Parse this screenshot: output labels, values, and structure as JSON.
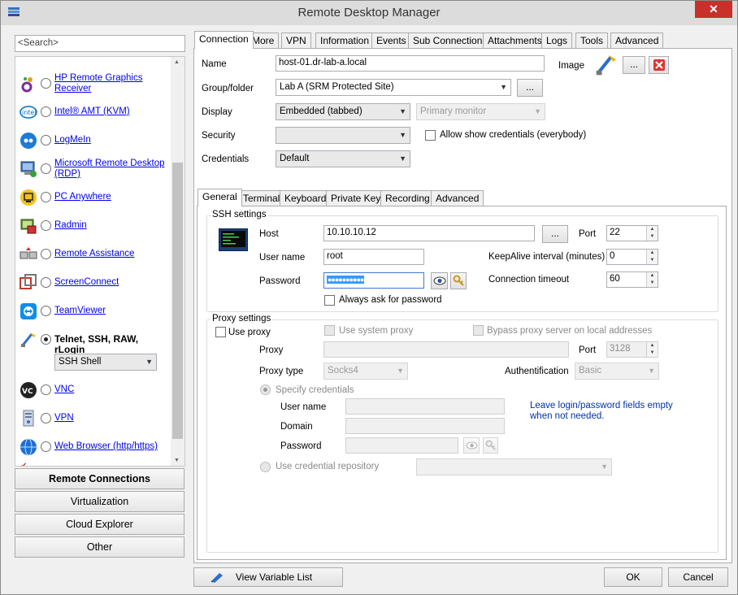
{
  "window": {
    "title": "Remote Desktop Manager",
    "close_glyph": "✕"
  },
  "sidebar": {
    "search_placeholder": "<Search>",
    "items": [
      {
        "label": "HP Remote Graphics Receiver",
        "icon": "hp-rgs-icon"
      },
      {
        "label": "Intel® AMT (KVM)",
        "icon": "intel-icon"
      },
      {
        "label": "LogMeIn",
        "icon": "logmein-icon"
      },
      {
        "label": "Microsoft Remote Desktop (RDP)",
        "icon": "rdp-icon"
      },
      {
        "label": "PC Anywhere",
        "icon": "pcanywhere-icon"
      },
      {
        "label": "Radmin",
        "icon": "radmin-icon"
      },
      {
        "label": "Remote Assistance",
        "icon": "remote-assistance-icon"
      },
      {
        "label": "ScreenConnect",
        "icon": "screenconnect-icon"
      },
      {
        "label": "TeamViewer",
        "icon": "teamviewer-icon"
      },
      {
        "label": "Telnet, SSH, RAW, rLogin",
        "icon": "telnet-ssh-icon",
        "selected": true
      },
      {
        "label": "VNC",
        "icon": "vnc-icon"
      },
      {
        "label": "VPN",
        "icon": "vpn-icon"
      },
      {
        "label": "Web Browser (http/https)",
        "icon": "web-browser-icon"
      }
    ],
    "ssh_type": "SSH Shell",
    "nav": [
      "Remote Connections",
      "Virtualization",
      "Cloud Explorer",
      "Other"
    ]
  },
  "tabs": [
    "Connection",
    "More",
    "VPN",
    "Information",
    "Events",
    "Sub Connections",
    "Attachments",
    "Logs",
    "Tools",
    "Advanced"
  ],
  "connection": {
    "name_label": "Name",
    "name_value": "host-01.dr-lab-a.local",
    "image_label": "Image",
    "image_browse": "...",
    "group_label": "Group/folder",
    "group_value": "Lab A (SRM Protected Site)",
    "group_browse": "...",
    "display_label": "Display",
    "display_value": "Embedded (tabbed)",
    "monitor_value": "Primary monitor",
    "security_label": "Security",
    "security_value": "",
    "allow_show_label": "Allow show credentials (everybody)",
    "credentials_label": "Credentials",
    "credentials_value": "Default"
  },
  "subtabs": [
    "General",
    "Terminal",
    "Keyboard",
    "Private Key",
    "Recording",
    "Advanced"
  ],
  "ssh": {
    "group_title": "SSH settings",
    "host_label": "Host",
    "host_value": "10.10.10.12",
    "host_browse": "...",
    "port_label": "Port",
    "port_value": "22",
    "user_label": "User name",
    "user_value": "root",
    "keepalive_label": "KeepAlive interval (minutes)",
    "keepalive_value": "0",
    "password_label": "Password",
    "password_value": "●●●●●●●●●●",
    "timeout_label": "Connection timeout",
    "timeout_value": "60",
    "always_ask_label": "Always ask for password"
  },
  "proxy": {
    "group_title": "Proxy settings",
    "use_proxy_label": "Use proxy",
    "use_system_label": "Use system proxy",
    "bypass_label": "Bypass proxy server on local addresses",
    "proxy_label": "Proxy",
    "proxy_value": "",
    "port_label": "Port",
    "port_value": "3128",
    "type_label": "Proxy type",
    "type_value": "Socks4",
    "auth_label": "Authentification",
    "auth_value": "Basic",
    "specify_label": "Specify credentials",
    "user_label": "User name",
    "domain_label": "Domain",
    "password_label": "Password",
    "hint": "Leave login/password fields empty when not needed.",
    "repo_label": "Use credential repository"
  },
  "footer": {
    "variables": "View Variable List",
    "ok": "OK",
    "cancel": "Cancel"
  },
  "colors": {
    "close": "#c7312a",
    "link": "#0000ee",
    "hint": "#0033aa"
  }
}
